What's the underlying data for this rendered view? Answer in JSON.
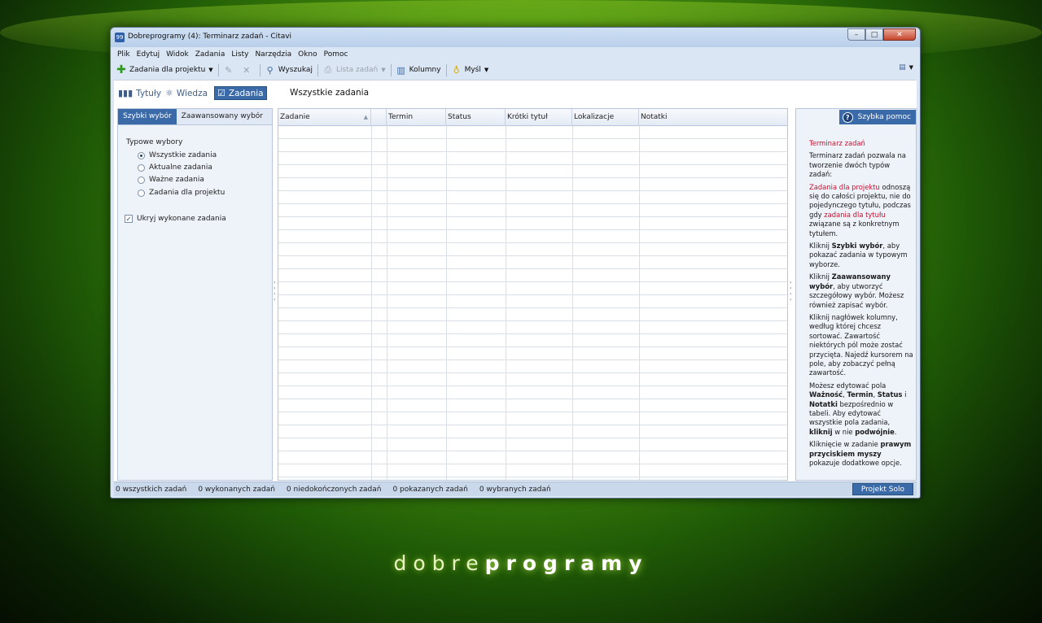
{
  "window": {
    "title": "Dobreprogramy (4): Terminarz zadań - Citavi",
    "app_icon": "citavi-icon"
  },
  "menu": [
    "Plik",
    "Edytuj",
    "Widok",
    "Zadania",
    "Listy",
    "Narzędzia",
    "Okno",
    "Pomoc"
  ],
  "toolbar": {
    "add_task": "Zadania dla projektu",
    "search": "Wyszukaj",
    "task_list": "Lista zadań",
    "columns": "Kolumny",
    "idea": "Myśl"
  },
  "nav": {
    "titles": "Tytuły",
    "knowledge": "Wiedza",
    "tasks": "Zadania",
    "heading": "Wszystkie zadania"
  },
  "left_panel": {
    "tab_quick": "Szybki wybór",
    "tab_advanced": "Zaawansowany wybór",
    "group_label": "Typowe wybory",
    "options": [
      "Wszystkie zadania",
      "Aktualne zadania",
      "Ważne zadania",
      "Zadania dla projektu"
    ],
    "selected_option": 0,
    "hide_done": "Ukryj wykonane zadania",
    "hide_done_checked": true
  },
  "grid": {
    "columns": [
      "Zadanie",
      "",
      "Termin",
      "Status",
      "Krótki tytuł",
      "Lokalizacje",
      "Notatki"
    ]
  },
  "help": {
    "button": "Szybka pomoc",
    "title": "Terminarz zadań",
    "p1": "Terminarz zadań pozwala na tworzenie dwóch typów zadań:",
    "p2_a": "Zadania dla projektu",
    "p2_b": " odnoszą się do całości projektu, nie do pojedynczego tytułu, podczas gdy ",
    "p2_c": "zadania dla tytułu",
    "p2_d": " związane są z konkretnym tytułem.",
    "p3_a": "Kliknij ",
    "p3_b": "Szybki wybór",
    "p3_c": ", aby pokazać zadania w typowym wyborze.",
    "p4_a": "Kliknij ",
    "p4_b": "Zaawansowany wybór",
    "p4_c": ", aby utworzyć szczegółowy wybór. Możesz również zapisać wybór.",
    "p5": "Kliknij nagłówek kolumny, według której chcesz sortować. Zawartość niektórych pól może zostać przycięta. Najedź kursorem na pole, aby zobaczyć pełną zawartość.",
    "p6_a": "Możesz edytować pola ",
    "p6_b": "Ważność",
    "p6_c": ", ",
    "p6_d": "Termin",
    "p6_e": ", ",
    "p6_f": "Status",
    "p6_g": " i ",
    "p6_h": "Notatki",
    "p6_i": " bezpośrednio w tabeli. Aby edytować wszystkie pola zadania, ",
    "p6_j": "kliknij",
    "p6_k": " w nie ",
    "p6_l": "podwójnie",
    "p6_m": ".",
    "p7_a": "Kliknięcie w zadanie ",
    "p7_b": "prawym przyciskiem myszy",
    "p7_c": " pokazuje dodatkowe opcje."
  },
  "status": {
    "all": "0 wszystkich zadań",
    "done": "0 wykonanych zadań",
    "unfinished": "0 niedokończonych zadań",
    "shown": "0 pokazanych zadań",
    "selected": "0 wybranych zadań",
    "project": "Projekt Solo"
  },
  "branding": {
    "light": "dobre",
    "bold": "programy"
  }
}
